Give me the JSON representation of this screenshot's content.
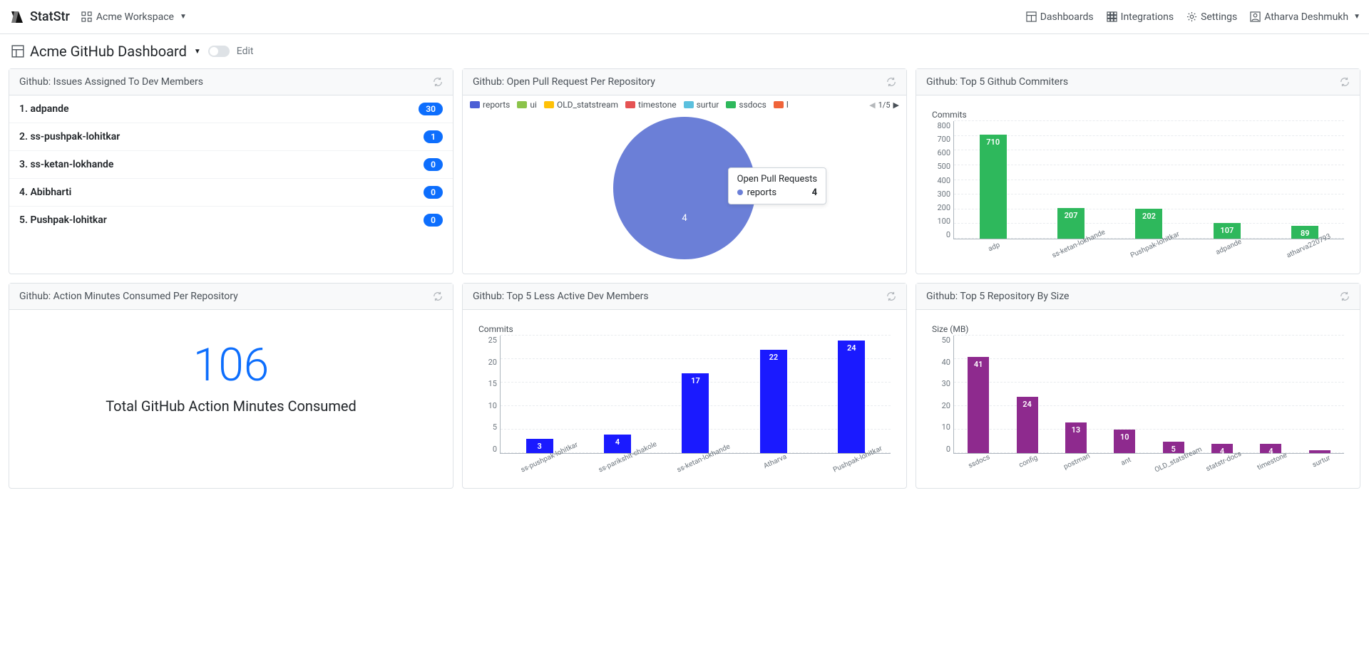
{
  "brand": "StatStr",
  "workspace": "Acme Workspace",
  "nav": {
    "dashboards": "Dashboards",
    "integrations": "Integrations",
    "settings": "Settings",
    "user": "Atharva Deshmukh"
  },
  "dashboardTitle": "Acme GitHub Dashboard",
  "editLabel": "Edit",
  "cards": {
    "issues": {
      "title": "Github: Issues Assigned To Dev Members",
      "rows": [
        {
          "n": "1.",
          "name": "adpande",
          "count": "30"
        },
        {
          "n": "2.",
          "name": "ss-pushpak-lohitkar",
          "count": "1"
        },
        {
          "n": "3.",
          "name": "ss-ketan-lokhande",
          "count": "0"
        },
        {
          "n": "4.",
          "name": "Abibharti",
          "count": "0"
        },
        {
          "n": "5.",
          "name": "Pushpak-lohitkar",
          "count": "0"
        }
      ]
    },
    "prs": {
      "title": "Github: Open Pull Request Per Repository",
      "legend": [
        {
          "label": "reports",
          "color": "#4c5fd5"
        },
        {
          "label": "ui",
          "color": "#8bc34a"
        },
        {
          "label": "OLD_statstream",
          "color": "#ffc107"
        },
        {
          "label": "timestone",
          "color": "#e55353"
        },
        {
          "label": "surtur",
          "color": "#5bc0de"
        },
        {
          "label": "ssdocs",
          "color": "#2eb85c"
        },
        {
          "label": "l",
          "color": "#f0643a"
        }
      ],
      "page": "1/5",
      "tooltip": {
        "title": "Open Pull Requests",
        "series": "reports",
        "value": "4"
      },
      "pieValue": "4"
    },
    "commiters": {
      "title": "Github: Top 5 Github Commiters",
      "axis": "Commits"
    },
    "minutes": {
      "title": "Github: Action Minutes Consumed Per Repository",
      "value": "106",
      "sub": "Total GitHub Action Minutes Consumed"
    },
    "lessActive": {
      "title": "Github: Top 5 Less Active Dev Members",
      "axis": "Commits"
    },
    "repoSize": {
      "title": "Github: Top 5 Repository By Size",
      "axis": "Size (MB)"
    }
  },
  "chart_data": [
    {
      "id": "commiters",
      "type": "bar",
      "title": "Commits",
      "ylim": [
        0,
        800
      ],
      "yticks": [
        0,
        100,
        200,
        300,
        400,
        500,
        600,
        700,
        800
      ],
      "categories": [
        "adp",
        "ss-ketan-lokhande",
        "Pushpak-lohitkar",
        "adpande",
        "atharva220793"
      ],
      "values": [
        710,
        207,
        202,
        107,
        89
      ],
      "color": "#2eb85c"
    },
    {
      "id": "prs_pie",
      "type": "pie",
      "categories": [
        "reports"
      ],
      "values": [
        4
      ],
      "title": "Open Pull Requests"
    },
    {
      "id": "lessActive",
      "type": "bar",
      "title": "Commits",
      "ylim": [
        0,
        25
      ],
      "yticks": [
        0,
        5,
        10,
        15,
        20,
        25
      ],
      "categories": [
        "ss-pushpak-lohitkar",
        "ss-parikshit-chakole",
        "ss-ketan-lokhande",
        "Atharva",
        "Pushpak-lohitkar"
      ],
      "values": [
        3,
        4,
        17,
        22,
        24
      ],
      "color": "#1a1aff"
    },
    {
      "id": "repoSize",
      "type": "bar",
      "title": "Size (MB)",
      "ylim": [
        0,
        50
      ],
      "yticks": [
        0,
        10,
        20,
        30,
        40,
        50
      ],
      "categories": [
        "ssdocs",
        "config",
        "postman",
        "ant",
        "OLD_statstream",
        "statstr-docs",
        "timestone",
        "surtur"
      ],
      "values": [
        41,
        24,
        13,
        10,
        5,
        4,
        4,
        1
      ],
      "color": "#8e2a8e"
    }
  ]
}
